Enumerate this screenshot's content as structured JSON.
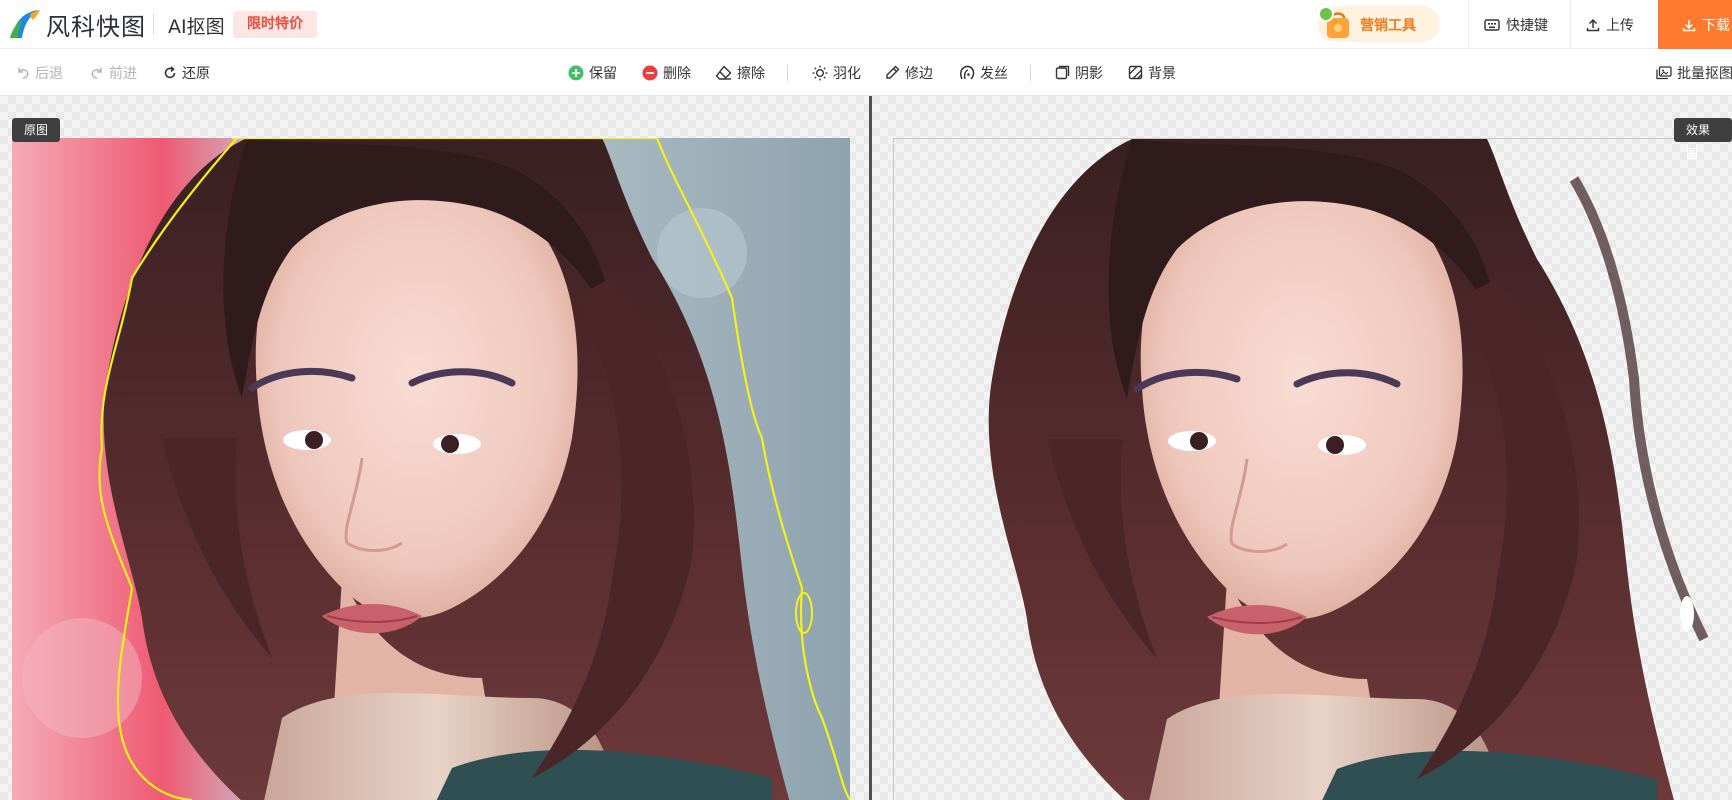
{
  "header": {
    "brand_name": "风科快图",
    "page_title": "AI抠图",
    "promo_badge": "限时特价",
    "marketing_label": "营销工具",
    "shortcuts_label": "快捷键",
    "upload_label": "上传",
    "download_label": "下载"
  },
  "toolbar": {
    "undo_label": "后退",
    "redo_label": "前进",
    "restore_label": "还原",
    "keep_label": "保留",
    "delete_label": "删除",
    "erase_label": "擦除",
    "feather_label": "羽化",
    "trim_label": "修边",
    "hair_label": "发丝",
    "shadow_label": "阴影",
    "background_label": "背景",
    "batch_label": "批量抠图"
  },
  "canvas": {
    "original_label": "原图",
    "result_label": "效果图"
  },
  "colors": {
    "accent_orange": "#ff7a2e",
    "promo_red": "#ef4b3f",
    "keep_green": "#3ec164",
    "delete_red": "#ee3b3b",
    "selection_yellow": "#f4f11a",
    "divider_dark": "#505050"
  },
  "icons": {
    "logo": "brand-logo",
    "marketing": "gift-bag-icon",
    "shortcuts": "keyboard-icon",
    "upload": "upload-icon",
    "download": "download-icon",
    "undo": "undo-icon",
    "redo": "redo-icon",
    "restore": "restore-icon",
    "keep": "plus-circle-icon",
    "delete": "minus-circle-icon",
    "erase": "eraser-icon",
    "feather": "feather-icon",
    "trim": "pen-icon",
    "hair": "hair-icon",
    "shadow": "shadow-icon",
    "background": "background-icon",
    "batch": "batch-icon"
  }
}
